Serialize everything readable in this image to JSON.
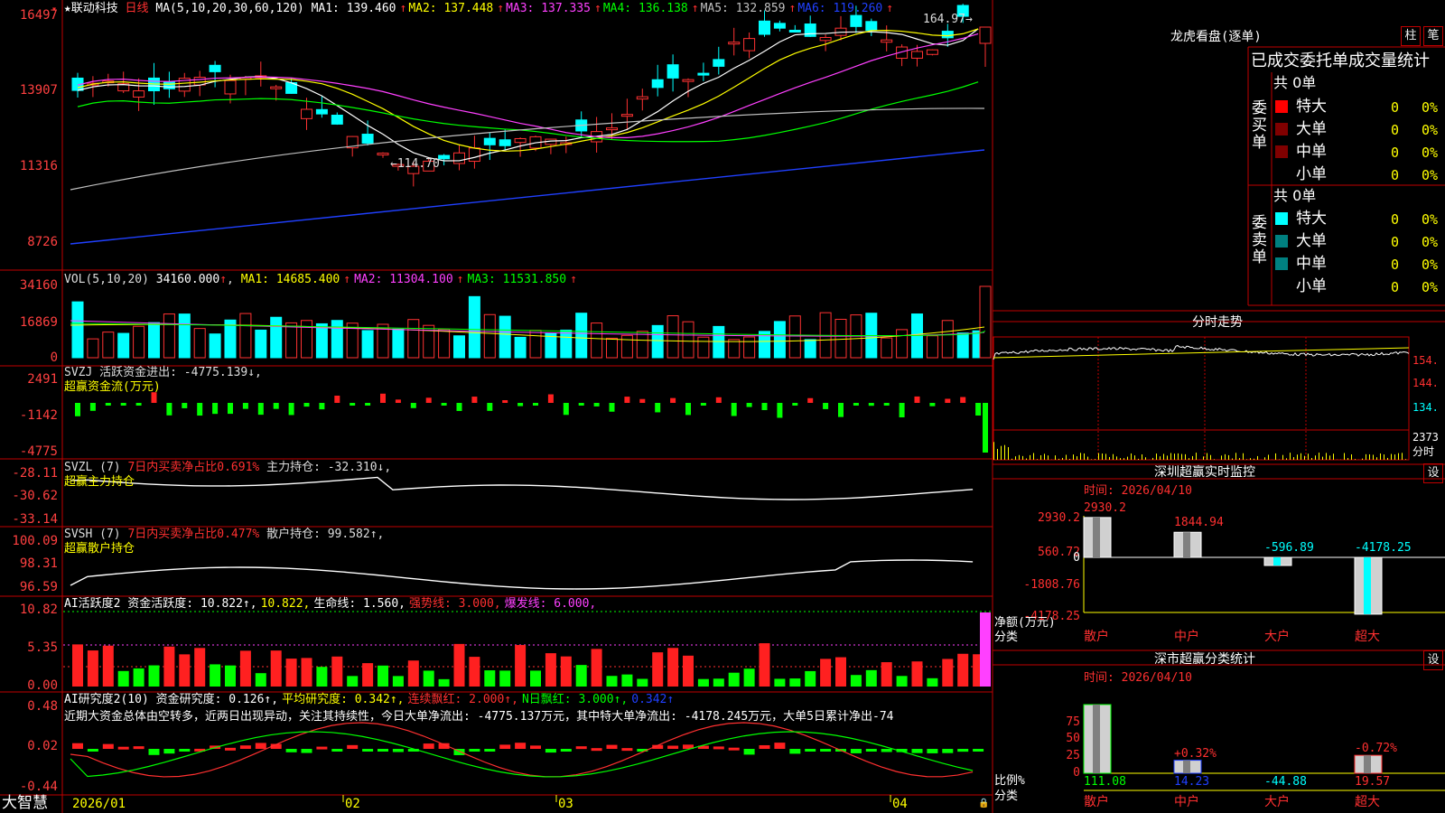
{
  "stock": {
    "star": "★",
    "name": "联动科技",
    "period": "日线"
  },
  "main_panel": {
    "ma_title": "MA(5,10,20,30,60,120)",
    "ma": [
      {
        "label": "MA1:",
        "value": "139.460",
        "arrow": "↑",
        "color": "#ffffff"
      },
      {
        "label": "MA2:",
        "value": "137.448",
        "arrow": "↑",
        "color": "#ffff00"
      },
      {
        "label": "MA3:",
        "value": "137.335",
        "arrow": "↑",
        "color": "#ff40ff"
      },
      {
        "label": "MA4:",
        "value": "136.138",
        "arrow": "↑",
        "color": "#00ff00"
      },
      {
        "label": "MA5:",
        "value": "132.859",
        "arrow": "↑",
        "color": "#c0c0c0"
      },
      {
        "label": "MA6:",
        "value": "119.260",
        "arrow": "↑",
        "color": "#2040ff"
      }
    ],
    "axis": [
      "16497",
      "13907",
      "11316",
      "8726"
    ],
    "high_note": "164.97",
    "low_note": "114.70"
  },
  "vol_panel": {
    "title": "VOL(5,10,20)",
    "value": "34160.000",
    "ma": [
      {
        "label": "MA1:",
        "value": "14685.400",
        "color": "#ffff00"
      },
      {
        "label": "MA2:",
        "value": "11304.100",
        "color": "#ff40ff"
      },
      {
        "label": "MA3:",
        "value": "11531.850",
        "color": "#00ff00"
      }
    ],
    "axis": [
      "34160",
      "16869",
      "0"
    ]
  },
  "svzj_panel": {
    "line1": "SVZJ  活跃资金进出: -4775.139↓,",
    "line2": "超赢资金流(万元)",
    "axis": [
      "2491",
      "-1142",
      "-4775"
    ]
  },
  "svzl_panel": {
    "p1": "SVZL (7)",
    "p2": "7日内买卖净占比0.691%",
    "p3": "主力持仓: -32.310↓,",
    "line2": "超赢主力持仓",
    "axis": [
      "-28.11",
      "-30.62",
      "-33.14"
    ]
  },
  "svsh_panel": {
    "p1": "SVSH (7)",
    "p2": "7日内买卖净占比0.477%",
    "p3": "散户持仓: 99.582↑,",
    "line2": "超赢散户持仓",
    "axis": [
      "100.09",
      "98.31",
      "96.59"
    ]
  },
  "ai_active_panel": {
    "parts": [
      {
        "text": "AI活跃度2 资金活跃度: 10.822↑,",
        "color": "#ffffff"
      },
      {
        "text": "10.822,",
        "color": "#ffff00"
      },
      {
        "text": "生命线: 1.560,",
        "color": "#ffffff"
      },
      {
        "text": "强势线: 3.000,",
        "color": "#ff3030"
      },
      {
        "text": "爆发线: 6.000,",
        "color": "#ff40ff"
      }
    ],
    "axis": [
      "10.82",
      "5.35",
      "0.00"
    ]
  },
  "ai_research_panel": {
    "parts": [
      {
        "text": "AI研究度2(10) 资金研究度: 0.126↑,",
        "color": "#ffffff"
      },
      {
        "text": "平均研究度: 0.342↑,",
        "color": "#ffff00"
      },
      {
        "text": "连续飘红: 2.000↑,",
        "color": "#ff3030"
      },
      {
        "text": "N日飘红: 3.000↑,",
        "color": "#00ff00"
      },
      {
        "text": "0.342↑",
        "color": "#2040ff"
      }
    ],
    "note": "近期大资金总体由空转多，近两日出现异动，关注其持续性，今日大单净流出: -4775.137万元，其中特大单净流出: -4178.245万元，大单5日累计净出-74",
    "axis": [
      "0.48",
      "0.02",
      "-0.44"
    ]
  },
  "time_axis": {
    "brand": "大智慧",
    "labels": [
      "2026/01",
      "02",
      "03",
      "04"
    ]
  },
  "dragon_panel": {
    "title": "龙虎看盘(逐单)",
    "btn_bar": "柱",
    "btn_pen": "笔",
    "subtitle": "已成交委托单成交量统计",
    "buy_label": "委买单",
    "sell_label": "委卖单",
    "buy_total": "共 0单",
    "sell_total": "共 0单",
    "buy_rows": [
      {
        "name": "特大",
        "count": "0",
        "pct": "0%",
        "color": "#ff0000"
      },
      {
        "name": "大单",
        "count": "0",
        "pct": "0%",
        "color": "#800000"
      },
      {
        "name": "中单",
        "count": "0",
        "pct": "0%",
        "color": "#800000"
      },
      {
        "name": "小单",
        "count": "0",
        "pct": "0%",
        "color": ""
      }
    ],
    "sell_rows": [
      {
        "name": "特大",
        "count": "0",
        "pct": "0%",
        "color": "#00ffff"
      },
      {
        "name": "大单",
        "count": "0",
        "pct": "0%",
        "color": "#008080"
      },
      {
        "name": "中单",
        "count": "0",
        "pct": "0%",
        "color": "#008080"
      },
      {
        "name": "小单",
        "count": "0",
        "pct": "0%",
        "color": ""
      }
    ]
  },
  "intraday_panel": {
    "title": "分时走势",
    "axis": [
      "154.",
      "144.",
      "134.",
      "2373",
      "分时"
    ]
  },
  "monitor_panel": {
    "title": "深圳超赢实时监控",
    "btn": "设",
    "time": "时间: 2026/04/10",
    "axis": [
      "2930.2",
      "560.72",
      "0",
      "-1808.76",
      "-4178.25"
    ],
    "ylabel1": "净额(万元)",
    "ylabel2": "分类",
    "chart_data": {
      "type": "bar",
      "categories": [
        "散户",
        "中户",
        "大户",
        "超大"
      ],
      "values": [
        2930.2,
        1844.94,
        -596.89,
        -4178.25
      ],
      "value_labels": [
        "2930.2",
        "1844.94",
        "-596.89",
        "-4178.25"
      ],
      "ylim": [
        -4178.25,
        2930.2
      ]
    }
  },
  "classify_panel": {
    "title": "深市超赢分类统计",
    "btn": "设",
    "time": "时间: 2026/04/10",
    "axis": [
      "75",
      "50",
      "25",
      "0"
    ],
    "ylabel1": "比例%",
    "ylabel2": "分类",
    "chart_data": {
      "type": "bar",
      "categories": [
        "散户",
        "中户",
        "大户",
        "超大"
      ],
      "values": [
        111.08,
        14.23,
        -44.88,
        19.57
      ],
      "pct_labels": [
        "",
        "+0.32%",
        "",
        "-0.72%"
      ],
      "value_labels": [
        "111.08",
        "14.23",
        "-44.88",
        "19.57"
      ],
      "ylim": [
        0,
        75
      ]
    }
  },
  "colors": {
    "up": "#ff3232",
    "down": "#00ffff",
    "grid": "#c00000",
    "green": "#00ff00",
    "magenta": "#ff40ff"
  }
}
